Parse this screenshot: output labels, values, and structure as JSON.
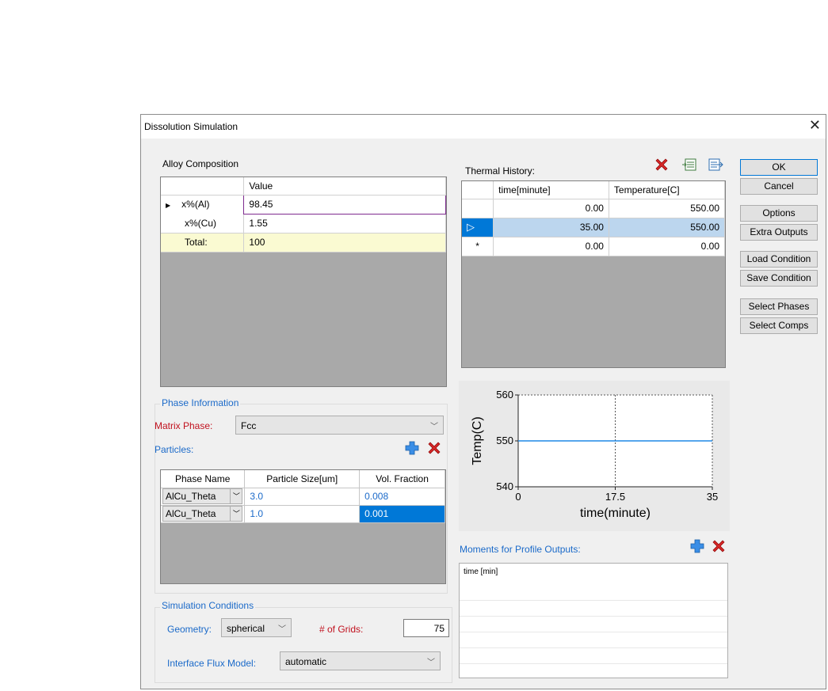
{
  "window": {
    "title": "Dissolution Simulation",
    "close": "✕"
  },
  "alloy": {
    "title": "Alloy Composition",
    "value_header": "Value",
    "rows": [
      {
        "name": "x%(Al)",
        "value": "98.45"
      },
      {
        "name": "x%(Cu)",
        "value": "1.55"
      },
      {
        "name": "Total:",
        "value": "100"
      }
    ]
  },
  "thermal": {
    "title": "Thermal History:",
    "headers": [
      "time[minute]",
      "Temperature[C]"
    ],
    "rows": [
      {
        "marker": "",
        "time": "0.00",
        "temp": "550.00"
      },
      {
        "marker": "▷",
        "time": "35.00",
        "temp": "550.00"
      },
      {
        "marker": "*",
        "time": "0.00",
        "temp": "0.00"
      }
    ]
  },
  "buttons": {
    "ok": "OK",
    "cancel": "Cancel",
    "options": "Options",
    "extra_outputs": "Extra Outputs",
    "load_condition": "Load Condition",
    "save_condition": "Save Condition",
    "select_phases": "Select Phases",
    "select_comps": "Select Comps"
  },
  "phase": {
    "group_title": "Phase Information",
    "matrix_label": "Matrix Phase:",
    "matrix_value": "Fcc",
    "particles_label": "Particles:",
    "headers": [
      "Phase Name",
      "Particle Size[um]",
      "Vol. Fraction"
    ],
    "rows": [
      {
        "name": "AlCu_Theta",
        "size": "3.0",
        "fraction": "0.008"
      },
      {
        "name": "AlCu_Theta",
        "size": "1.0",
        "fraction": "0.001"
      }
    ]
  },
  "sim": {
    "group_title": "Simulation Conditions",
    "geometry_label": "Geometry:",
    "geometry_value": "spherical",
    "grids_label": "# of Grids:",
    "grids_value": "75",
    "flux_label": "Interface Flux Model:",
    "flux_value": "automatic"
  },
  "moments": {
    "title": "Moments for Profile Outputs:",
    "header": "time [min]"
  },
  "chart_data": {
    "type": "line",
    "xlabel": "time(minute)",
    "ylabel": "Temp(C)",
    "xlim": [
      0,
      35
    ],
    "ylim": [
      540,
      560
    ],
    "xticks": [
      "0",
      "17.5",
      "35"
    ],
    "yticks": [
      "540",
      "550",
      "560"
    ],
    "series": [
      {
        "x": [
          0,
          35
        ],
        "y": [
          550,
          550
        ]
      }
    ],
    "grid": true,
    "line_color": "#1e88e5"
  }
}
